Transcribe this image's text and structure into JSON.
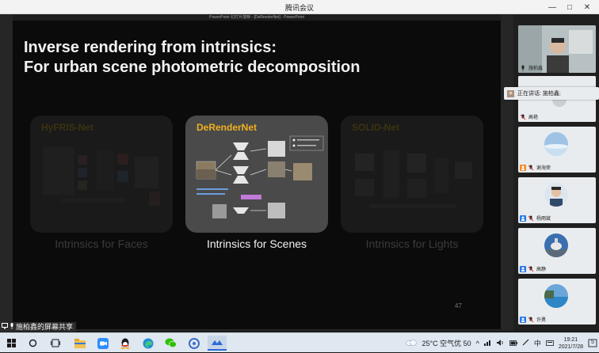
{
  "window": {
    "title": "腾讯会议",
    "minimize": "—",
    "maximize": "□",
    "close": "✕"
  },
  "slide": {
    "ppt_caption": "PowerPoint 幻灯片放映 - [DeRenderNet] - PowerPoint",
    "title_line1": "Inverse rendering from intrinsics:",
    "title_line2": "For urban scene photometric decomposition",
    "panels": [
      {
        "name": "HyFRIS-Net",
        "caption": "Intrinsics for Faces"
      },
      {
        "name": "DeRenderNet",
        "caption": "Intrinsics for Scenes"
      },
      {
        "name": "SOLID-Net",
        "caption": "Intrinsics for Lights"
      }
    ],
    "page_number": "47"
  },
  "share_label": "施柏鑫的屏幕共享",
  "participants": [
    {
      "name": "施柏鑫",
      "type": "video"
    },
    {
      "name": "高艳",
      "type": "video-partial"
    },
    {
      "name": "谢海荣",
      "type": "avatar",
      "avatar": "sky"
    },
    {
      "name": "杨雨斌",
      "type": "avatar",
      "avatar": "person"
    },
    {
      "name": "高静",
      "type": "avatar",
      "avatar": "dome"
    },
    {
      "name": "许勇",
      "type": "avatar",
      "avatar": "sea"
    }
  ],
  "speaking_banner": "正在讲话: 施柏鑫;",
  "taskbar": {
    "weather": "25°C 空气优 50",
    "ime": "中",
    "time": "19:21",
    "date": "2021/7/28",
    "notification_count": "5"
  },
  "icons": [
    "windows-start-icon",
    "search-icon",
    "task-view-icon",
    "file-explorer-icon",
    "zoom-icon",
    "qq-icon",
    "edge-icon",
    "wechat-icon",
    "browser-icon",
    "tencent-meeting-icon"
  ],
  "colors": {
    "accent_orange": "#f0b020",
    "taskbar_bg": "#dfe7f0",
    "slide_bg": "#0b0b0b"
  }
}
